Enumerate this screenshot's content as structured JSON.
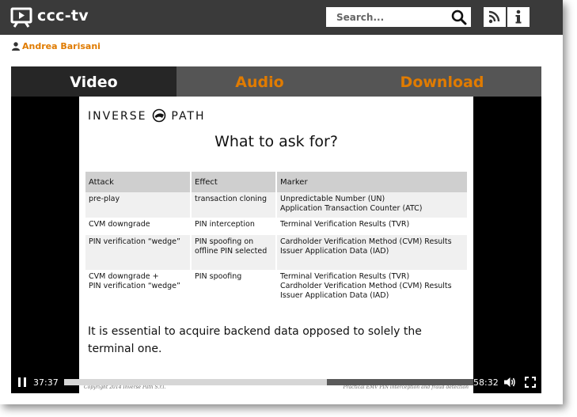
{
  "header": {
    "site_title": "ccc-tv",
    "search_placeholder": "Search...",
    "logo_icon": "tv-play-icon",
    "rss_icon": "rss-icon",
    "info_icon": "info-icon"
  },
  "author": {
    "name": "Andrea Barisani",
    "icon": "user-icon"
  },
  "tabs": [
    {
      "label": "Video",
      "active": true
    },
    {
      "label": "Audio",
      "active": false
    },
    {
      "label": "Download",
      "active": false
    }
  ],
  "slide": {
    "brand_left": "INVERSE",
    "brand_right": "PATH",
    "title": "What to ask for?",
    "table": {
      "headers": [
        "Attack",
        "Effect",
        "Marker"
      ],
      "rows": [
        [
          "pre-play",
          "transaction cloning",
          "Unpredictable Number (UN)\nApplication Transaction Counter (ATC)"
        ],
        [
          "CVM downgrade",
          "PIN interception",
          "Terminal Verification Results (TVR)"
        ],
        [
          "PIN verification “wedge”",
          "PIN spoofing on\noffline PIN selected",
          "Cardholder Verification Method (CVM) Results\nIssuer Application Data (IAD)"
        ],
        [
          "CVM downgrade +\nPIN verification “wedge”",
          "PIN spoofing",
          "Terminal Verification Results (TVR)\nCardholder Verification Method (CVM) Results\nIssuer Application Data (IAD)"
        ]
      ]
    },
    "body": "It is essential to acquire backend data opposed to solely the terminal one.",
    "copyright": "Copyright 2014 Inverse Path S.r.l.",
    "note": "Practical EMV PIN interception and fraud detection"
  },
  "player": {
    "elapsed": "37:37",
    "total": "58:32",
    "progress": 0.6426,
    "play_icon": "pause-icon",
    "volume_icon": "volume-icon",
    "fullscreen_icon": "fullscreen-icon"
  },
  "colors": {
    "accent": "#e07b00",
    "topbar": "#3a3a3a",
    "tab_active": "#262626",
    "tab_inactive": "#555555"
  }
}
